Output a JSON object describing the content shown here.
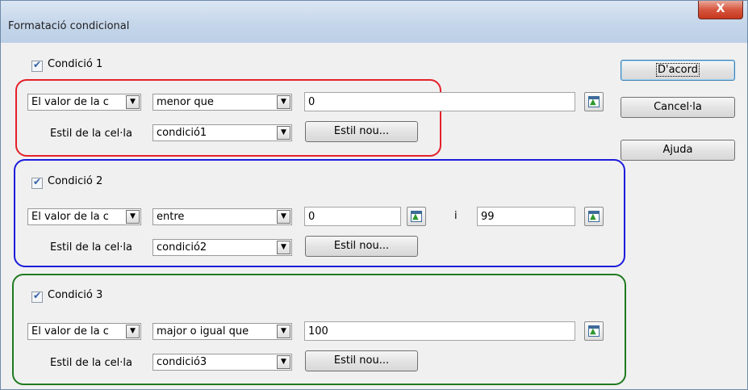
{
  "window": {
    "title": "Formatació condicional",
    "close_label": "X"
  },
  "buttons": {
    "ok": "D'acord",
    "cancel": "Cancel·la",
    "help": "Ajuda"
  },
  "conditions": [
    {
      "label": "Condició 1",
      "checked": true,
      "type": "El valor de la c",
      "operator": "menor que",
      "value1": "0",
      "value2": "",
      "and_label": "",
      "style_label": "Estil de la cel·la",
      "style": "condició1",
      "new_style": "Estil nou...",
      "frame_color": "#e5202a"
    },
    {
      "label": "Condició 2",
      "checked": true,
      "type": "El valor de la c",
      "operator": "entre",
      "value1": "0",
      "value2": "99",
      "and_label": "i",
      "style_label": "Estil de la cel·la",
      "style": "condició2",
      "new_style": "Estil nou...",
      "frame_color": "#1c1cdc"
    },
    {
      "label": "Condició 3",
      "checked": true,
      "type": "El valor de la c",
      "operator": "major o igual que",
      "value1": "100",
      "value2": "",
      "and_label": "",
      "style_label": "Estil de la cel·la",
      "style": "condició3",
      "new_style": "Estil nou...",
      "frame_color": "#1f7a1f"
    }
  ]
}
